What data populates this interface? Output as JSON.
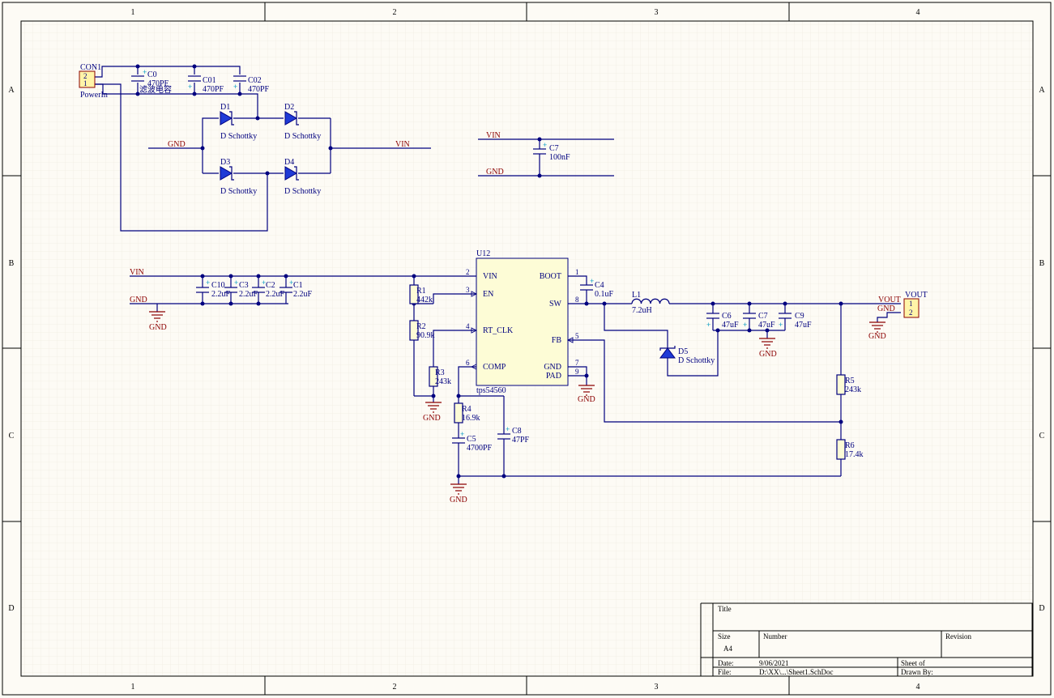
{
  "frame": {
    "columns": [
      "1",
      "2",
      "3",
      "4"
    ],
    "rows": [
      "A",
      "B",
      "C",
      "D"
    ]
  },
  "connectors": {
    "con1": {
      "ref": "CON1",
      "pins": [
        "2",
        "1"
      ],
      "name": "PowerIn"
    },
    "vout": {
      "ref": "VOUT",
      "pins": [
        "1",
        "2"
      ]
    }
  },
  "caps": {
    "c0": {
      "ref": "C0",
      "value": "470PF"
    },
    "c0_note": "滤波电容",
    "c01": {
      "ref": "C01",
      "value": "470PF"
    },
    "c02": {
      "ref": "C02",
      "value": "470PF"
    },
    "c7a": {
      "ref": "C7",
      "value": "100nF"
    },
    "c10": {
      "ref": "C10",
      "value": "2.2uF"
    },
    "c3": {
      "ref": "C3",
      "value": "2.2uF"
    },
    "c2": {
      "ref": "C2",
      "value": "2.2uF"
    },
    "c1": {
      "ref": "C1",
      "value": "2.2uF"
    },
    "c4": {
      "ref": "C4",
      "value": "0.1uF"
    },
    "c6": {
      "ref": "C6",
      "value": "47uF"
    },
    "c7b": {
      "ref": "C7",
      "value": "47uF"
    },
    "c9": {
      "ref": "C9",
      "value": "47uF"
    },
    "c5": {
      "ref": "C5",
      "value": "4700PF"
    },
    "c8": {
      "ref": "C8",
      "value": "47PF"
    }
  },
  "diodes": {
    "d1": {
      "ref": "D1",
      "value": "D Schottky"
    },
    "d2": {
      "ref": "D2",
      "value": "D Schottky"
    },
    "d3": {
      "ref": "D3",
      "value": "D Schottky"
    },
    "d4": {
      "ref": "D4",
      "value": "D Schottky"
    },
    "d5": {
      "ref": "D5",
      "value": "D Schottky"
    }
  },
  "resistors": {
    "r1": {
      "ref": "R1",
      "value": "442k"
    },
    "r2": {
      "ref": "R2",
      "value": "90.9k"
    },
    "r3": {
      "ref": "R3",
      "value": "243k"
    },
    "r4": {
      "ref": "R4",
      "value": "16.9k"
    },
    "r5": {
      "ref": "R5",
      "value": "243k"
    },
    "r6": {
      "ref": "R6",
      "value": "17.4k"
    }
  },
  "inductor": {
    "ref": "L1",
    "value": "7.2uH"
  },
  "nets": {
    "gnd": "GND",
    "vin": "VIN",
    "vout": "VOUT"
  },
  "ic": {
    "ref": "U12",
    "part": "tps54560",
    "pins": {
      "vin": {
        "num": "2",
        "name": "VIN"
      },
      "en": {
        "num": "3",
        "name": "EN"
      },
      "rt": {
        "num": "4",
        "name": "RT_CLK"
      },
      "comp": {
        "num": "6",
        "name": "COMP"
      },
      "boot": {
        "num": "1",
        "name": "BOOT"
      },
      "sw": {
        "num": "8",
        "name": "SW"
      },
      "fb": {
        "num": "5",
        "name": "FB"
      },
      "gnd": {
        "num": "7",
        "name": "GND"
      },
      "pad": {
        "num": "9",
        "name": "PAD"
      }
    }
  },
  "titleblock": {
    "title": "Title",
    "size_label": "Size",
    "size": "A4",
    "number_label": "Number",
    "revision_label": "Revision",
    "date_label": "Date:",
    "date": "9/06/2021",
    "file_label": "File:",
    "file": "D:\\XX\\...\\Sheet1.SchDoc",
    "sheet_label": "Sheet   of",
    "drawn_label": "Drawn By:"
  },
  "colors": {
    "wire": "#00007f",
    "net_label": "#8b0000",
    "ic_fill": "#fdfcd6",
    "connector_fill": "#fff4a8",
    "diode_fill": "#1f3bd6",
    "background": "#fdfbf5"
  }
}
